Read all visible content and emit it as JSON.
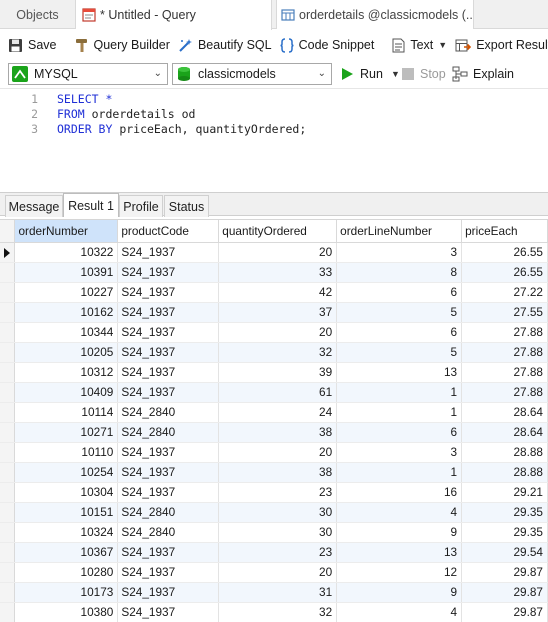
{
  "tabs": {
    "objects": "Objects",
    "query": "* Untitled - Query",
    "details": "orderdetails @classicmodels (..."
  },
  "toolbar": {
    "save": "Save",
    "query_builder": "Query Builder",
    "beautify": "Beautify SQL",
    "snippet": "Code Snippet",
    "text": "Text",
    "export": "Export Result"
  },
  "connection": {
    "server": "MYSQL",
    "database": "classicmodels",
    "run": "Run",
    "stop": "Stop",
    "explain": "Explain"
  },
  "editor": {
    "line_numbers": [
      "1",
      "2",
      "3"
    ],
    "line1_kw": "SELECT *",
    "line2_kw": "FROM",
    "line2_rest": " orderdetails od",
    "line3_kw": "ORDER BY",
    "line3_rest": " priceEach, quantityOrdered;"
  },
  "result_tabs": [
    "Message",
    "Result 1",
    "Profile",
    "Status"
  ],
  "active_result_tab": "Result 1",
  "grid": {
    "columns": [
      "orderNumber",
      "productCode",
      "quantityOrdered",
      "orderLineNumber",
      "priceEach"
    ],
    "selected_column": "orderNumber",
    "rows": [
      [
        "10322",
        "S24_1937",
        "20",
        "3",
        "26.55"
      ],
      [
        "10391",
        "S24_1937",
        "33",
        "8",
        "26.55"
      ],
      [
        "10227",
        "S24_1937",
        "42",
        "6",
        "27.22"
      ],
      [
        "10162",
        "S24_1937",
        "37",
        "5",
        "27.55"
      ],
      [
        "10344",
        "S24_1937",
        "20",
        "6",
        "27.88"
      ],
      [
        "10205",
        "S24_1937",
        "32",
        "5",
        "27.88"
      ],
      [
        "10312",
        "S24_1937",
        "39",
        "13",
        "27.88"
      ],
      [
        "10409",
        "S24_1937",
        "61",
        "1",
        "27.88"
      ],
      [
        "10114",
        "S24_2840",
        "24",
        "1",
        "28.64"
      ],
      [
        "10271",
        "S24_2840",
        "38",
        "6",
        "28.64"
      ],
      [
        "10110",
        "S24_1937",
        "20",
        "3",
        "28.88"
      ],
      [
        "10254",
        "S24_1937",
        "38",
        "1",
        "28.88"
      ],
      [
        "10304",
        "S24_1937",
        "23",
        "16",
        "29.21"
      ],
      [
        "10151",
        "S24_2840",
        "30",
        "4",
        "29.35"
      ],
      [
        "10324",
        "S24_2840",
        "30",
        "9",
        "29.35"
      ],
      [
        "10367",
        "S24_1937",
        "23",
        "13",
        "29.54"
      ],
      [
        "10280",
        "S24_1937",
        "20",
        "12",
        "29.87"
      ],
      [
        "10173",
        "S24_1937",
        "31",
        "9",
        "29.87"
      ],
      [
        "10380",
        "S24_1937",
        "32",
        "4",
        "29.87"
      ]
    ]
  },
  "colors": {
    "keyword": "#1f2fd6",
    "selected_header": "#cfe3fa",
    "alt_row": "#f2f7fd",
    "run_green": "#1aa31a"
  }
}
